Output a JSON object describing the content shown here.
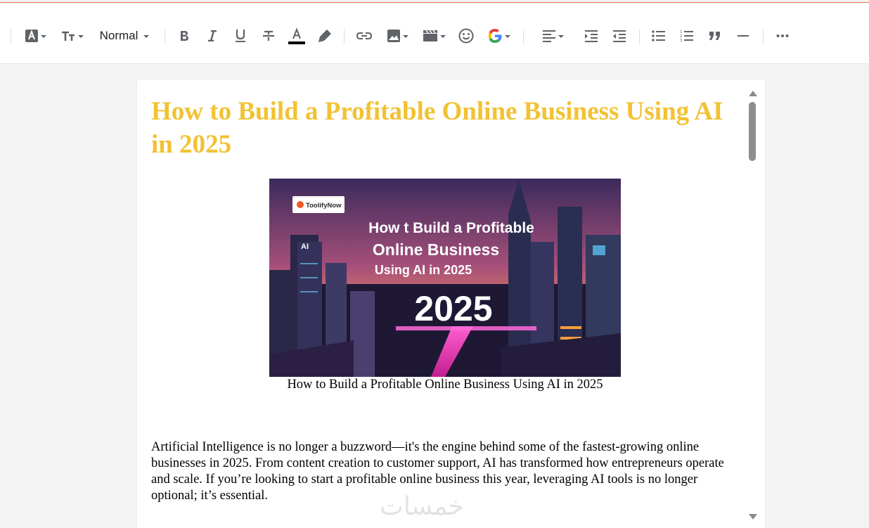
{
  "toolbar": {
    "paragraph_format": "Normal",
    "font_color_underline": "#000000",
    "google_colors": [
      "#4285f4",
      "#ea4335",
      "#fbbc05",
      "#34a853"
    ]
  },
  "post": {
    "title": "How to Build a Profitable Online Business Using AI in 2025",
    "title_color": "#f1c232",
    "image": {
      "logo_text": "ToolifyNow",
      "line1": "How t  Build a Profitable",
      "line2": "Online Business",
      "line3": "Using  AI in 2025",
      "year": "2025",
      "sign_text": "AI"
    },
    "caption": "How to Build a Profitable Online Business Using AI in 2025",
    "paragraph": "Artificial Intelligence is no longer a buzzword—it's the engine behind some of the fastest-growing online businesses in 2025. From content creation to customer support, AI has transformed how entrepreneurs operate and scale. If you’re looking to start a profitable online business this year, leveraging AI tools is no longer optional; it’s essential."
  },
  "watermark": "خمسات"
}
